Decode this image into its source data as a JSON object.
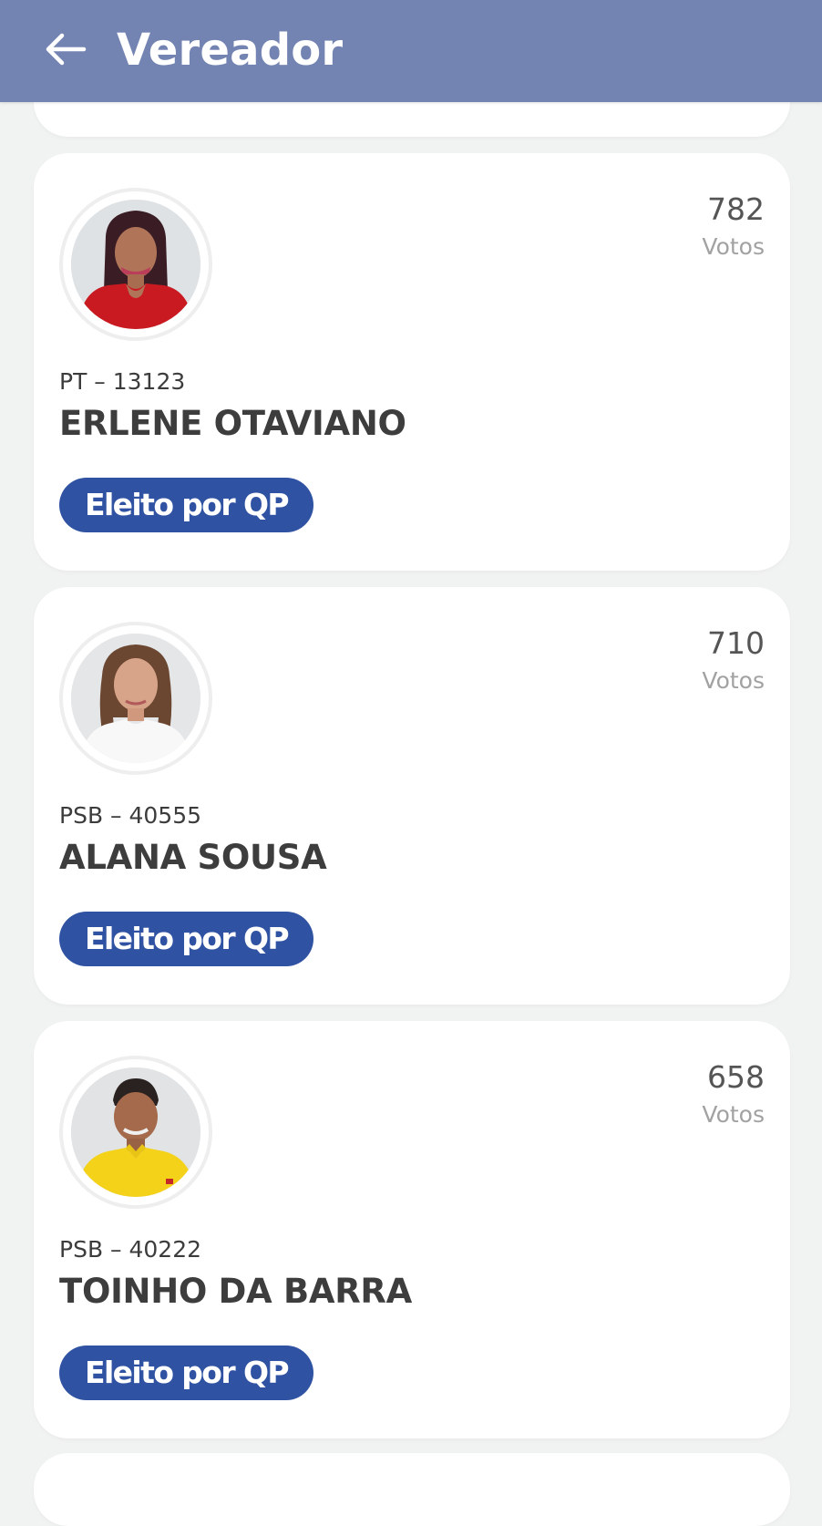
{
  "header": {
    "title": "Vereador",
    "back_icon": "arrow-left-icon",
    "background": "#7484b2"
  },
  "candidates": [
    {
      "votes": "782",
      "votes_label": "Votos",
      "party_number": "PT – 13123",
      "name": "ERLENE OTAVIANO",
      "status": "Eleito por QP",
      "photo": "candidate-photo-woman-red-top"
    },
    {
      "votes": "710",
      "votes_label": "Votos",
      "party_number": "PSB – 40555",
      "name": "ALANA SOUSA",
      "status": "Eleito por QP",
      "photo": "candidate-photo-woman-white-top"
    },
    {
      "votes": "658",
      "votes_label": "Votos",
      "party_number": "PSB – 40222",
      "name": "TOINHO DA BARRA",
      "status": "Eleito por QP",
      "photo": "candidate-photo-man-yellow-shirt"
    }
  ],
  "colors": {
    "badge": "#2f52a2",
    "page_background": "#f1f2f2",
    "card_background": "#ffffff"
  }
}
